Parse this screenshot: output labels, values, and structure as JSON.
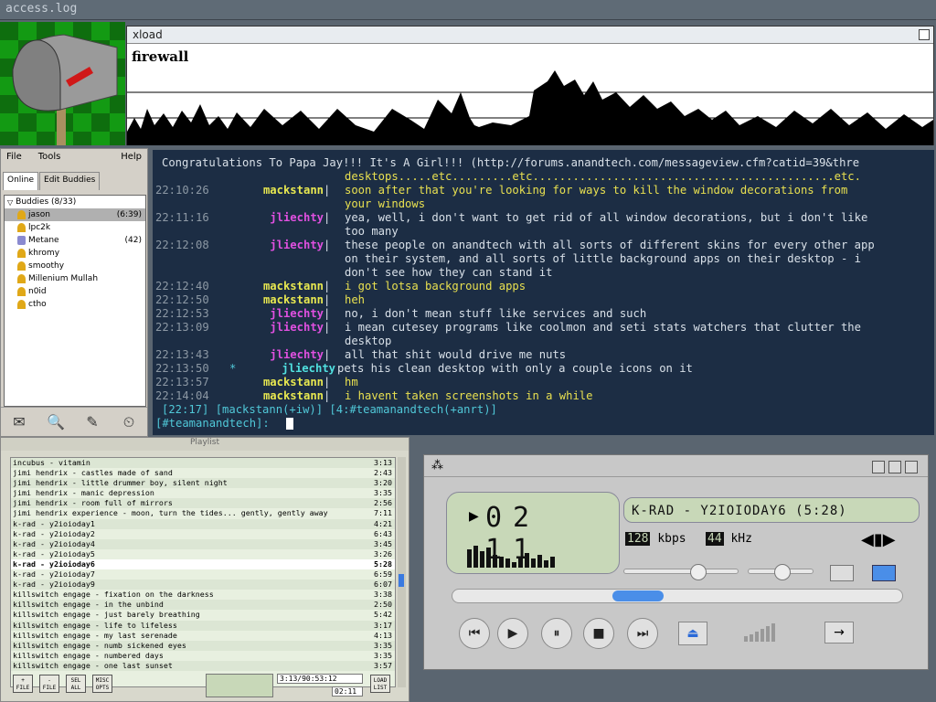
{
  "topbar": {
    "title": "access.log"
  },
  "xload": {
    "title": "xload",
    "label": "firewall"
  },
  "buddy": {
    "menu": [
      "File",
      "Tools",
      "Help"
    ],
    "tabs": [
      "Online",
      "Edit Buddies"
    ],
    "group": "Buddies (8/33)",
    "items": [
      {
        "name": "jason",
        "time": "(6:39)",
        "selected": true
      },
      {
        "name": "lpc2k",
        "time": ""
      },
      {
        "name": "Metane",
        "time": "(42)"
      },
      {
        "name": "khromy",
        "time": ""
      },
      {
        "name": "smoothy",
        "time": ""
      },
      {
        "name": "Millenium Mullah",
        "time": ""
      },
      {
        "name": "n0id",
        "time": ""
      },
      {
        "name": "ctho",
        "time": ""
      }
    ]
  },
  "irc": {
    "topic1": "Congratulations To Papa Jay!!! It's A Girl!!! (http://forums.anandtech.com/messageview.cfm?catid=39&thre",
    "topic2": "desktops.....etc.........etc.............................................etc.",
    "lines": [
      {
        "ts": "22:10:26",
        "nick": "mackstann",
        "cls": "c-mack",
        "msg": "soon after that you're looking for ways to kill the window decorations from",
        "cont": [
          "your windows"
        ],
        "msgcls": "c-yel"
      },
      {
        "ts": "22:11:16",
        "nick": "jliechty",
        "cls": "c-jl",
        "msg": "yea, well, i don't want to get rid of all window decorations, but i don't like",
        "cont": [
          "too many"
        ],
        "msgcls": ""
      },
      {
        "ts": "22:12:08",
        "nick": "jliechty",
        "cls": "c-jl",
        "msg": "these people on anandtech with all sorts of different skins for every other app",
        "cont": [
          "on their system, and all sorts of little background apps on their desktop - i",
          "don't see how they can stand it"
        ],
        "msgcls": ""
      },
      {
        "ts": "22:12:40",
        "nick": "mackstann",
        "cls": "c-mack",
        "msg": "i got lotsa background apps",
        "cont": [],
        "msgcls": "c-yel"
      },
      {
        "ts": "22:12:50",
        "nick": "mackstann",
        "cls": "c-mack",
        "msg": "heh",
        "cont": [],
        "msgcls": "c-yel"
      },
      {
        "ts": "22:12:53",
        "nick": "jliechty",
        "cls": "c-jl",
        "msg": "no, i don't mean stuff like services and such",
        "cont": [],
        "msgcls": ""
      },
      {
        "ts": "22:13:09",
        "nick": "jliechty",
        "cls": "c-jl",
        "msg": "i mean cutesey programs like coolmon and seti stats watchers that clutter the",
        "cont": [
          "desktop"
        ],
        "msgcls": ""
      },
      {
        "ts": "22:13:43",
        "nick": "jliechty",
        "cls": "c-jl",
        "msg": "all that shit would drive me nuts",
        "cont": [],
        "msgcls": ""
      },
      {
        "ts": "22:13:50",
        "nick": "jliechty",
        "cls": "c-act",
        "action": true,
        "msg": "pets his clean desktop with only a couple icons on it",
        "cont": [],
        "msgcls": ""
      },
      {
        "ts": "22:13:57",
        "nick": "mackstann",
        "cls": "c-mack",
        "msg": "hm",
        "cont": [],
        "msgcls": "c-yel"
      },
      {
        "ts": "22:14:04",
        "nick": "mackstann",
        "cls": "c-mack",
        "msg": "i havent taken screenshots in a while",
        "cont": [],
        "msgcls": "c-yel"
      }
    ],
    "status": "[22:17] [mackstann(+iw)] [4:#teamanandtech(+anrt)]",
    "prompt": "[#teamanandtech]: "
  },
  "playlist": {
    "title": "Playlist",
    "items": [
      [
        "incubus - vitamin",
        "3:13"
      ],
      [
        "jimi hendrix - castles made of sand",
        "2:43"
      ],
      [
        "jimi hendrix - little drummer boy, silent night",
        "3:20"
      ],
      [
        "jimi hendrix - manic depression",
        "3:35"
      ],
      [
        "jimi hendrix - room full of mirrors",
        "2:56"
      ],
      [
        "jimi hendrix experience - moon, turn the tides... gently, gently away",
        "7:11"
      ],
      [
        "k-rad - y2ioioday1",
        "4:21"
      ],
      [
        "k-rad - y2ioioday2",
        "6:43"
      ],
      [
        "k-rad - y2ioioday4",
        "3:45"
      ],
      [
        "k-rad - y2ioioday5",
        "3:26"
      ],
      [
        "k-rad - y2ioioday6",
        "5:28"
      ],
      [
        "k-rad - y2ioioday7",
        "6:59"
      ],
      [
        "k-rad - y2ioioday9",
        "6:07"
      ],
      [
        "killswitch engage - fixation on the darkness",
        "3:38"
      ],
      [
        "killswitch engage - in the unbind",
        "2:50"
      ],
      [
        "killswitch engage - just barely breathing",
        "5:42"
      ],
      [
        "killswitch engage - life to lifeless",
        "3:17"
      ],
      [
        "killswitch engage - my last serenade",
        "4:13"
      ],
      [
        "killswitch engage - numb sickened eyes",
        "3:35"
      ],
      [
        "killswitch engage - numbered days",
        "3:35"
      ],
      [
        "killswitch engage - one last sunset",
        "3:57"
      ]
    ],
    "current_index": 10,
    "buttons": [
      "+ FILE",
      "- FILE",
      "SEL ALL",
      "MISC OPTS",
      "LOAD LIST"
    ],
    "total_time": "3:13/90:53:12",
    "position": "02:11"
  },
  "xmms": {
    "time": "02 11",
    "song": "K-RAD - Y2IOIODAY6 (5:28)",
    "kbps": "128",
    "kbps_unit": "kbps",
    "khz": "44",
    "khz_unit": "kHz",
    "progress": 0.4
  }
}
